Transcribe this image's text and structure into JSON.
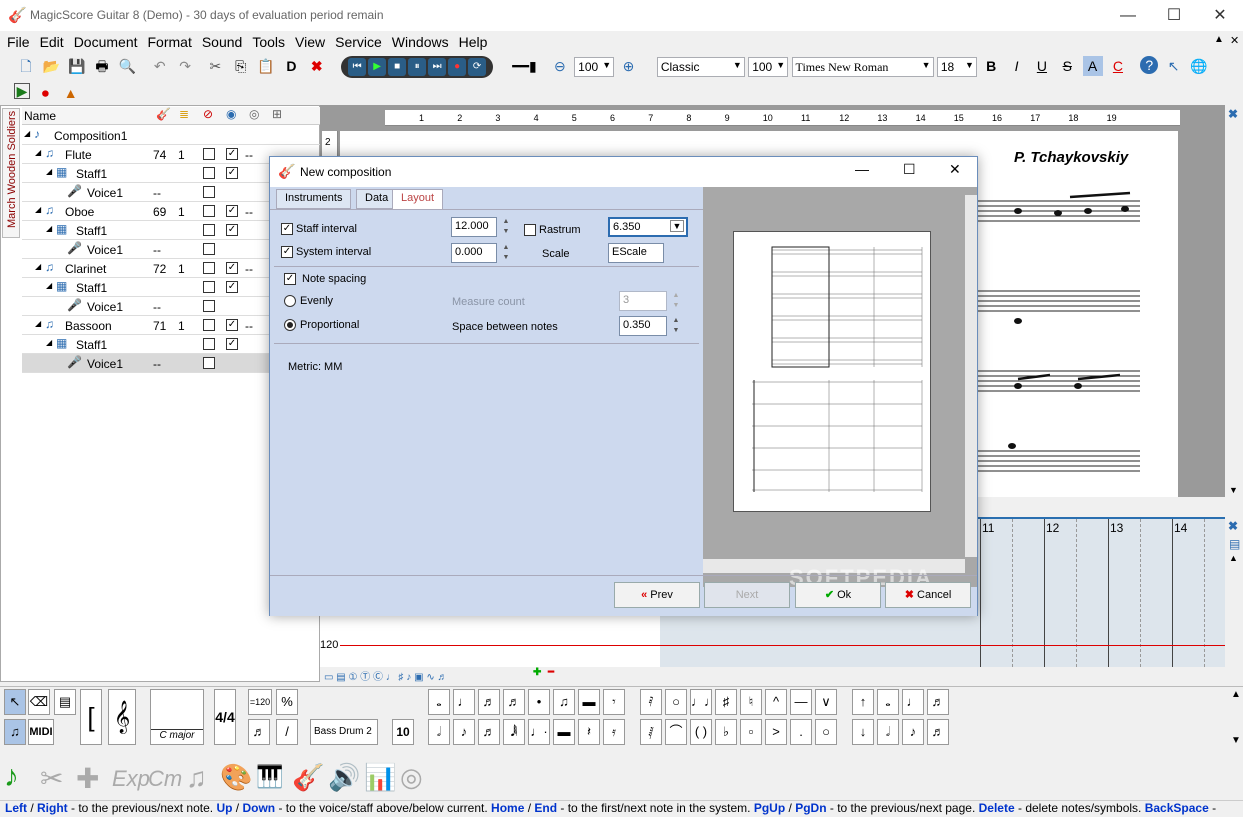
{
  "window": {
    "title": "MagicScore Guitar 8 (Demo) - 30 days of evaluation period remain",
    "minimize": "—",
    "maximize": "☐",
    "close": "✕"
  },
  "menu": [
    "File",
    "Edit",
    "Document",
    "Format",
    "Sound",
    "Tools",
    "View",
    "Service",
    "Windows",
    "Help"
  ],
  "toolbar": {
    "bold_d": "D",
    "zoom": "100",
    "style": "Classic",
    "style_zoom": "100",
    "font": "Times New Roman",
    "font_size": "18",
    "bold": "B",
    "italic": "I",
    "underline": "U",
    "strike": "S",
    "font_a": "A",
    "color_c": "C"
  },
  "side_tab": "March Wooden Soldiers",
  "tree": {
    "header": "Name",
    "rows": [
      {
        "label": "Composition1",
        "num1": "",
        "num2": "",
        "dash": ""
      },
      {
        "label": "Flute",
        "num1": "74",
        "num2": "1",
        "dash": "--"
      },
      {
        "label": "Staff1",
        "num1": "",
        "num2": "",
        "dash": ""
      },
      {
        "label": "Voice1",
        "num1": "--",
        "num2": "",
        "dash": ""
      },
      {
        "label": "Oboe",
        "num1": "69",
        "num2": "1",
        "dash": "--"
      },
      {
        "label": "Staff1",
        "num1": "",
        "num2": "",
        "dash": ""
      },
      {
        "label": "Voice1",
        "num1": "--",
        "num2": "",
        "dash": ""
      },
      {
        "label": "Clarinet",
        "num1": "72",
        "num2": "1",
        "dash": "--"
      },
      {
        "label": "Staff1",
        "num1": "",
        "num2": "",
        "dash": ""
      },
      {
        "label": "Voice1",
        "num1": "--",
        "num2": "",
        "dash": ""
      },
      {
        "label": "Bassoon",
        "num1": "71",
        "num2": "1",
        "dash": "--"
      },
      {
        "label": "Staff1",
        "num1": "",
        "num2": "",
        "dash": ""
      },
      {
        "label": "Voice1",
        "num1": "--",
        "num2": "",
        "dash": ""
      }
    ]
  },
  "score": {
    "composer": "P. Tchaykovskiy",
    "ruler": [
      "1",
      "2",
      "3",
      "4",
      "5",
      "6",
      "7",
      "8",
      "9",
      "10",
      "11",
      "12",
      "13",
      "14",
      "15",
      "16",
      "17",
      "18",
      "19"
    ],
    "side_ruler": "2"
  },
  "roll": {
    "measures": [
      "11",
      "12",
      "13",
      "14"
    ],
    "tempo": "120"
  },
  "dialog": {
    "title": "New composition",
    "tabs": [
      "Instruments",
      "Data",
      "Layout"
    ],
    "staff_interval_label": "Staff interval",
    "staff_interval": "12.000",
    "system_interval_label": "System interval",
    "system_interval": "0.000",
    "rastrum_label": "Rastrum",
    "rastrum": "6.350",
    "scale_label": "Scale",
    "scale": "EScale",
    "note_spacing_label": "Note spacing",
    "evenly_label": "Evenly",
    "proportional_label": "Proportional",
    "measure_count_label": "Measure count",
    "measure_count": "3",
    "space_label": "Space between notes",
    "space": "0.350",
    "metric": "Metric: MM",
    "prev": "Prev",
    "next": "Next",
    "ok": "Ok",
    "cancel": "Cancel",
    "watermark": "SOFTPEDIA"
  },
  "palette": {
    "key": "C major",
    "drum": "Bass Drum 2",
    "tempo": "=120",
    "ten": "10",
    "midi": "MIDI"
  },
  "status": [
    {
      "k": "Left",
      "t": " / "
    },
    {
      "k": "Right",
      "t": " - to the previous/next note. "
    },
    {
      "k": "Up",
      "t": " / "
    },
    {
      "k": "Down",
      "t": " - to the voice/staff above/below current. "
    },
    {
      "k": "Home",
      "t": " / "
    },
    {
      "k": "End",
      "t": " - to the first/next note in the system. "
    },
    {
      "k": "PgUp",
      "t": " / "
    },
    {
      "k": "PgDn",
      "t": " - to the previous/next page. "
    },
    {
      "k": "Delete",
      "t": " - delete notes/symbols. "
    },
    {
      "k": "BackSpace",
      "t": " -"
    }
  ]
}
